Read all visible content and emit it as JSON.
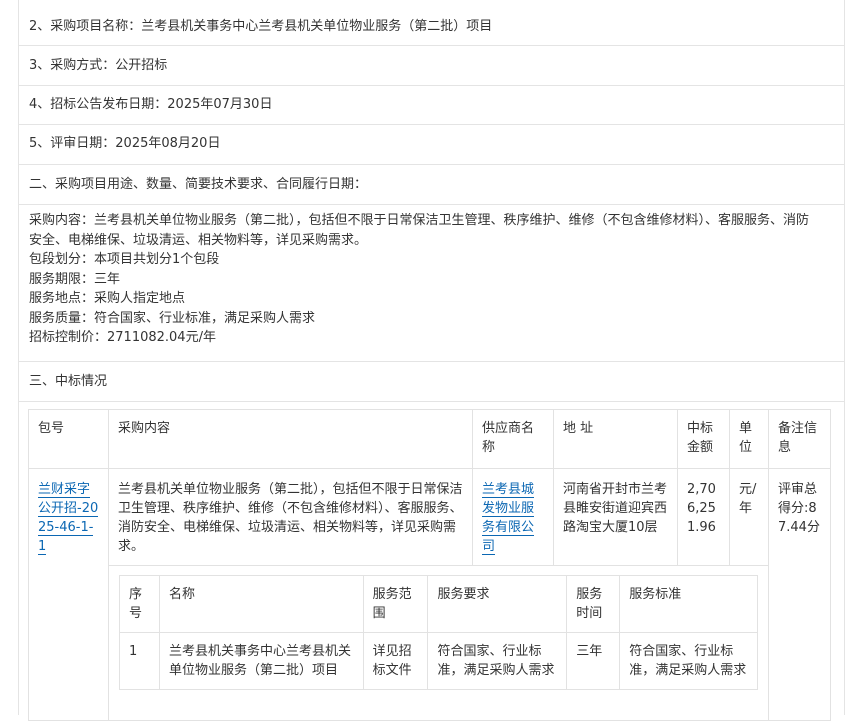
{
  "rows": {
    "item2": "2、采购项目名称：兰考县机关事务中心兰考县机关单位物业服务（第二批）项目",
    "item3": "3、采购方式：公开招标",
    "item4": "4、招标公告发布日期：2025年07月30日",
    "item5": "5、评审日期：2025年08月20日",
    "section2": "二、采购项目用途、数量、简要技术要求、合同履行日期：",
    "section3": "三、中标情况"
  },
  "details": {
    "line1": "采购内容：兰考县机关单位物业服务（第二批），包括但不限于日常保洁卫生管理、秩序维护、维修（不包含维修材料）、客服服务、消防",
    "line2": "安全、电梯维保、垃圾清运、相关物料等，详见采购需求。",
    "line3": "包段划分：本项目共划分1个包段",
    "line4": "服务期限：三年",
    "line5": "服务地点：采购人指定地点",
    "line6": "服务质量：符合国家、行业标准，满足采购人需求",
    "line7": "招标控制价：2711082.04元/年"
  },
  "table": {
    "headers": [
      "包号",
      "采购内容",
      "供应商名称",
      "地 址",
      "中标金额",
      "单位",
      "备注信息"
    ],
    "row": {
      "package": "兰财采字公开招-2025-46-1-1",
      "content": "兰考县机关单位物业服务（第二批），包括但不限于日常保洁卫生管理、秩序维护、维修（不包含维修材料）、客服服务、消防安全、电梯维保、垃圾清运、相关物料等，详见采购需求。",
      "supplier": "兰考县城发物业服务有限公司",
      "address": "河南省开封市兰考县睢安街道迎宾西路淘宝大厦10层",
      "amount": "2,706,251.96",
      "unit": "元/年",
      "remark": "评审总得分:87.44分"
    },
    "sub": {
      "headers": [
        "序号",
        "名称",
        "服务范围",
        "服务要求",
        "服务时间",
        "服务标准"
      ],
      "row": [
        "1",
        "兰考县机关事务中心兰考县机关单位物业服务（第二批）项目",
        "详见招标文件",
        "符合国家、行业标准，满足采购人需求",
        "三年",
        "符合国家、行业标准，满足采购人需求"
      ]
    }
  }
}
